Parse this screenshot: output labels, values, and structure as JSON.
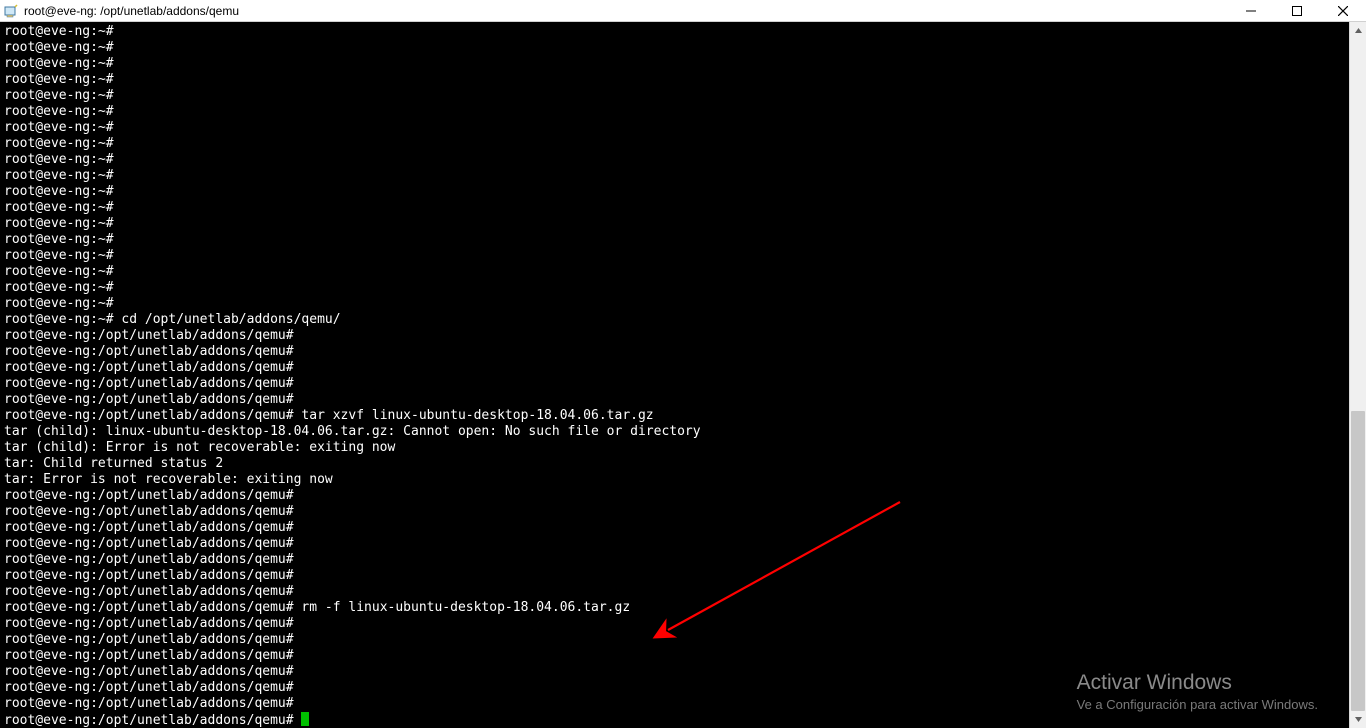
{
  "window": {
    "title": "root@eve-ng: /opt/unetlab/addons/qemu"
  },
  "prompt_home": "root@eve-ng:~#",
  "prompt_qemu": "root@eve-ng:/opt/unetlab/addons/qemu#",
  "commands": {
    "cd": "cd /opt/unetlab/addons/qemu/",
    "tar": "tar xzvf linux-ubuntu-desktop-18.04.06.tar.gz",
    "rm": "rm -f linux-ubuntu-desktop-18.04.06.tar.gz"
  },
  "errors": {
    "e1": "tar (child): linux-ubuntu-desktop-18.04.06.tar.gz: Cannot open: No such file or directory",
    "e2": "tar (child): Error is not recoverable: exiting now",
    "e3": "tar: Child returned status 2",
    "e4": "tar: Error is not recoverable: exiting now"
  },
  "watermark": {
    "line1": "Activar Windows",
    "line2": "Ve a Configuración para activar Windows."
  }
}
